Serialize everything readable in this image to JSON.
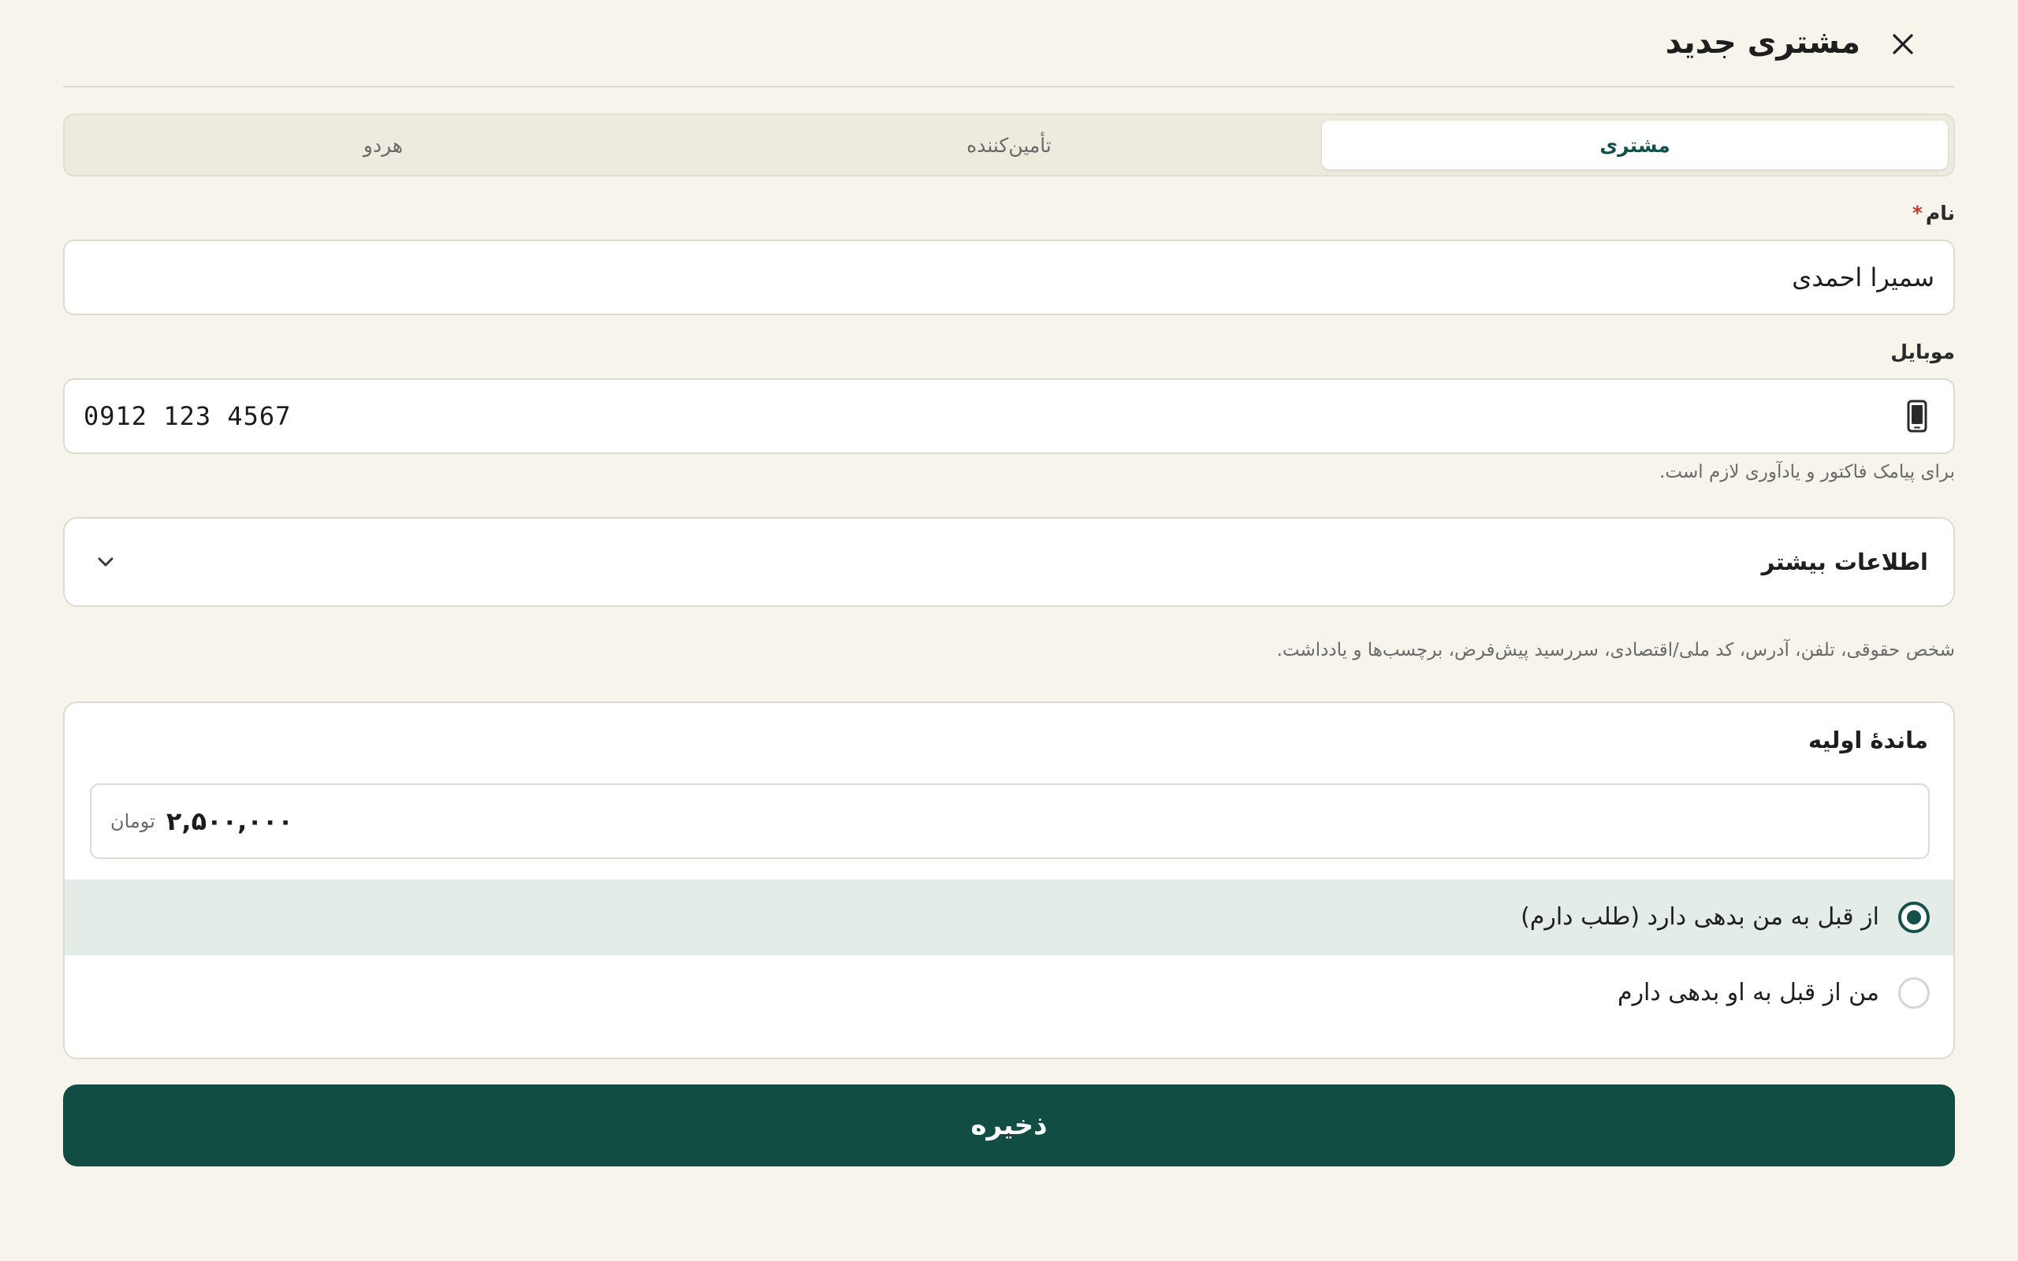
{
  "header": {
    "title": "مشتری جدید",
    "close_icon": "close-icon"
  },
  "type_tabs": {
    "selected": "مشتری",
    "items": [
      {
        "label": "مشتری"
      },
      {
        "label": "تأمین‌کننده"
      },
      {
        "label": "هردو"
      }
    ]
  },
  "name_field": {
    "label": "نام",
    "required_mark": "*",
    "value": "سمیرا احمدی"
  },
  "mobile_field": {
    "label": "موبایل",
    "value": "0912 123 4567",
    "icon": "phone-icon",
    "helper": "برای پیامک فاکتور و یادآوری لازم است."
  },
  "more_info": {
    "title": "اطلاعات بیشتر",
    "icon": "chevron-down-icon",
    "hint": "شخص حقوقی، تلفن، آدرس، کد ملی/اقتصادی، سررسید پیش‌فرض، برچسب‌ها و یادداشت."
  },
  "initial_balance": {
    "title": "ماندهٔ اولیه",
    "amount": "۲,۵۰۰,۰۰۰",
    "currency": "تومان",
    "options": [
      {
        "label": "از قبل به من بدهی دارد (طلب دارم)",
        "selected": true
      },
      {
        "label": "من از قبل به او بدهی دارم",
        "selected": false
      }
    ]
  },
  "actions": {
    "save_label": "ذخیره"
  },
  "colors": {
    "background": "#f7f4ec",
    "accent": "#124d44",
    "selected_row": "#e3ece7",
    "required": "#c0392b"
  }
}
